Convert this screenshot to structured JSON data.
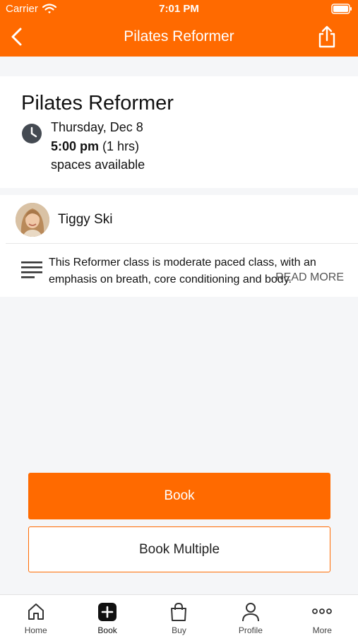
{
  "status_bar": {
    "carrier": "Carrier",
    "time": "7:01 PM"
  },
  "nav": {
    "title": "Pilates Reformer",
    "back_icon": "chevron-left-icon",
    "share_icon": "share-icon"
  },
  "class_info": {
    "title": "Pilates Reformer",
    "date": "Thursday, Dec 8",
    "time": "5:00 pm",
    "duration": "(1 hrs)",
    "spaces": "spaces available"
  },
  "teacher": {
    "name": "Tiggy Ski"
  },
  "description": {
    "text": "This Reformer class is moderate paced class, with an emphasis on breath, core conditioning and body.",
    "read_more": "READ MORE"
  },
  "actions": {
    "book": "Book",
    "book_multiple": "Book Multiple"
  },
  "tabs": [
    {
      "label": "Home",
      "icon": "home-icon"
    },
    {
      "label": "Book",
      "icon": "plus-square-icon"
    },
    {
      "label": "Buy",
      "icon": "shopping-bag-icon"
    },
    {
      "label": "Profile",
      "icon": "person-icon"
    },
    {
      "label": "More",
      "icon": "more-dots-icon"
    }
  ],
  "colors": {
    "accent": "#ff6a00",
    "background": "#f5f6f8"
  }
}
